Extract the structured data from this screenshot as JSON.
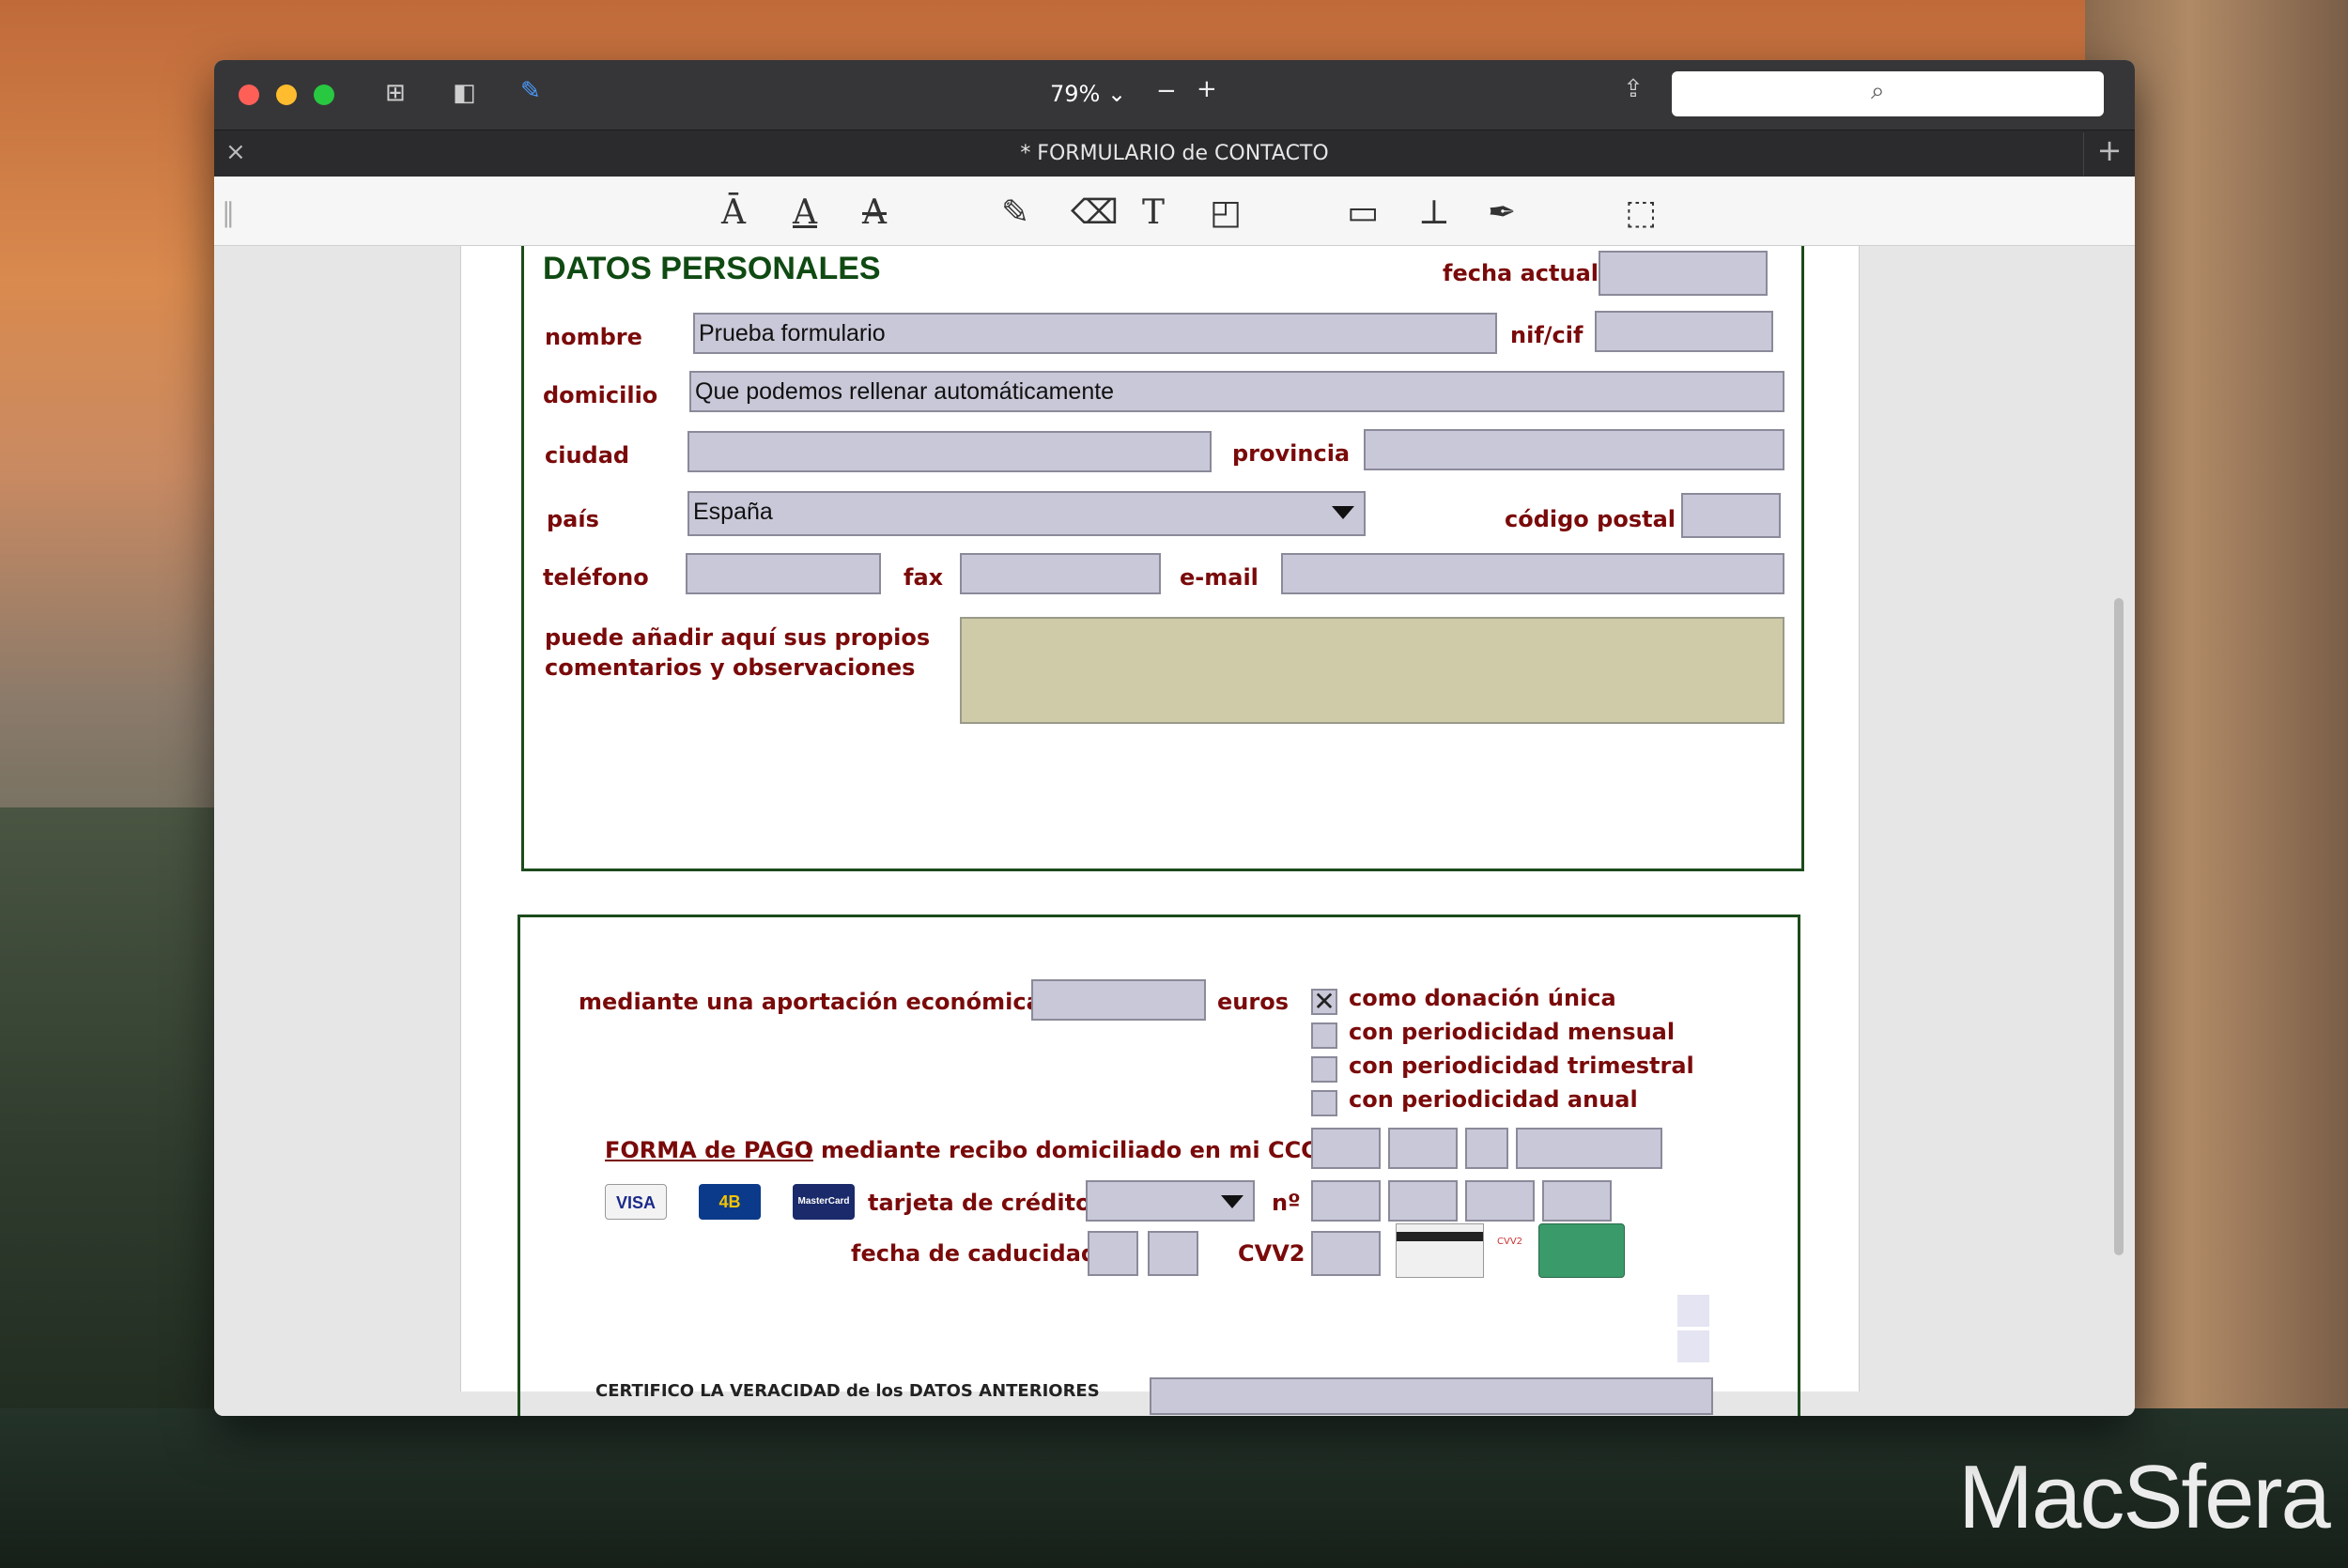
{
  "window": {
    "zoom": "79%",
    "zoom_out": "−",
    "zoom_in": "+",
    "document_title": "* FORMULARIO de CONTACTO",
    "close_tab": "×",
    "new_tab": "+"
  },
  "watermark": "MacSfera",
  "form": {
    "section1": {
      "heading": "DATOS PERSONALES",
      "fecha_actual_label": "fecha actual",
      "nombre_label": "nombre",
      "nombre_value": "Prueba formulario",
      "nif_label": "nif/cif",
      "domicilio_label": "domicilio",
      "domicilio_value": "Que podemos rellenar automáticamente",
      "ciudad_label": "ciudad",
      "provincia_label": "provincia",
      "pais_label": "país",
      "pais_value": "España",
      "codigo_postal_label": "código postal",
      "telefono_label": "teléfono",
      "fax_label": "fax",
      "email_label": "e-mail",
      "comentarios_label_1": "puede añadir aquí sus propios",
      "comentarios_label_2": "comentarios y observaciones"
    },
    "section2": {
      "aportacion_label": "mediante una aportación económica de",
      "euros_label": "euros",
      "options": [
        {
          "label": "como donación única",
          "checked": true
        },
        {
          "label": "con periodicidad mensual",
          "checked": false
        },
        {
          "label": "con periodicidad trimestral",
          "checked": false
        },
        {
          "label": "con periodicidad anual",
          "checked": false
        }
      ],
      "forma_pago_label": "FORMA de PAGO",
      "recibo_label": ": mediante recibo domiciliado en mi CCC nº",
      "card_visa": "VISA",
      "card_4b": "4B",
      "card_mastercard": "MasterCard",
      "tarjeta_label": "tarjeta de crédito",
      "numero_label": "nº",
      "caducidad_label": "fecha de caducidad",
      "cvv2_label": "CVV2",
      "cvv2_hint": "CVV2",
      "certifico_label": "CERTIFICO LA VERACIDAD de los DATOS ANTERIORES"
    }
  }
}
